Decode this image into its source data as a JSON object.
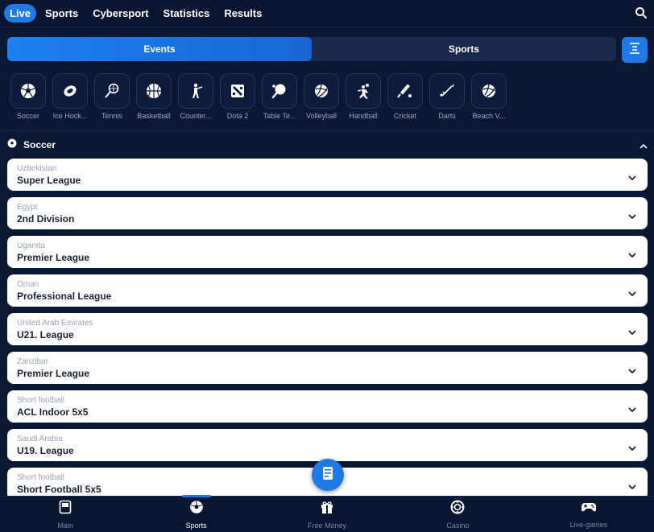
{
  "topnav": {
    "items": [
      "Live",
      "Sports",
      "Cybersport",
      "Statistics",
      "Results"
    ],
    "active": "Live"
  },
  "segment": {
    "events_label": "Events",
    "sports_label": "Sports"
  },
  "sports": [
    {
      "label": "Soccer",
      "icon": "soccer-ball-icon"
    },
    {
      "label": "Ice Hock...",
      "icon": "hockey-puck-icon"
    },
    {
      "label": "Tennis",
      "icon": "tennis-racket-icon"
    },
    {
      "label": "Basketball",
      "icon": "basketball-icon"
    },
    {
      "label": "Counter...",
      "icon": "counter-strike-icon"
    },
    {
      "label": "Dota 2",
      "icon": "dota-icon"
    },
    {
      "label": "Table Te...",
      "icon": "ping-pong-icon"
    },
    {
      "label": "Volleyball",
      "icon": "volleyball-icon"
    },
    {
      "label": "Handball",
      "icon": "handball-icon"
    },
    {
      "label": "Cricket",
      "icon": "cricket-icon"
    },
    {
      "label": "Darts",
      "icon": "darts-icon"
    },
    {
      "label": "Beach V...",
      "icon": "beach-volleyball-icon"
    }
  ],
  "section": {
    "title": "Soccer"
  },
  "leagues": [
    {
      "country": "Uzbekistan",
      "name": "Super League"
    },
    {
      "country": "Egypt",
      "name": "2nd Division"
    },
    {
      "country": "Uganda",
      "name": "Premier League"
    },
    {
      "country": "Oman",
      "name": "Professional League"
    },
    {
      "country": "United Arab Emirates",
      "name": "U21. League"
    },
    {
      "country": "Zanzibar",
      "name": "Premier League"
    },
    {
      "country": "Short football",
      "name": "ACL Indoor 5x5"
    },
    {
      "country": "Saudi Arabia",
      "name": "U19. League"
    },
    {
      "country": "Short football",
      "name": "Short Football 5x5"
    }
  ],
  "bottomnav": {
    "items": [
      {
        "label": "Main",
        "icon": "main-icon"
      },
      {
        "label": "Sports",
        "icon": "soccer-ball-icon"
      },
      {
        "label": "Free Money",
        "icon": "gift-icon"
      },
      {
        "label": "Casino",
        "icon": "casino-chip-icon"
      },
      {
        "label": "Live-games",
        "icon": "gamepad-icon"
      }
    ],
    "active": "Sports"
  },
  "colors": {
    "accent": "#1f7ae6",
    "background": "#0b1833",
    "card": "#ffffff"
  }
}
